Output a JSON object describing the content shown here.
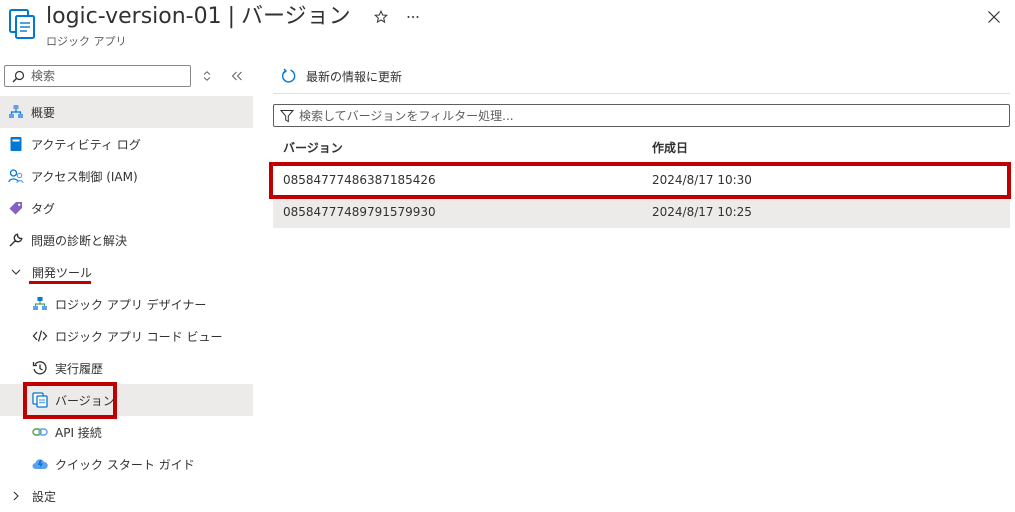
{
  "header": {
    "title": "logic-version-01",
    "separator": "|",
    "section": "バージョン",
    "subtitle": "ロジック アプリ",
    "favorite_icon": "star-icon",
    "more_icon": "ellipsis-icon",
    "close_icon": "close-icon"
  },
  "sidebar": {
    "search": {
      "placeholder": "検索",
      "value": ""
    },
    "items": [
      {
        "label": "概要",
        "icon": "overview-icon"
      },
      {
        "label": "アクティビティ ログ",
        "icon": "activity-log-icon"
      },
      {
        "label": "アクセス制御 (IAM)",
        "icon": "iam-icon"
      },
      {
        "label": "タグ",
        "icon": "tag-icon"
      },
      {
        "label": "問題の診断と解決",
        "icon": "wrench-icon"
      },
      {
        "label": "開発ツール",
        "icon": "chevron-down-icon"
      },
      {
        "label": "ロジック アプリ デザイナー",
        "icon": "designer-icon"
      },
      {
        "label": "ロジック アプリ コード ビュー",
        "icon": "code-icon"
      },
      {
        "label": "実行履歴",
        "icon": "history-icon"
      },
      {
        "label": "バージョン",
        "icon": "versions-icon"
      },
      {
        "label": "API 接続",
        "icon": "api-connection-icon"
      },
      {
        "label": "クイック スタート ガイド",
        "icon": "quickstart-icon"
      },
      {
        "label": "設定",
        "icon": "chevron-right-icon"
      }
    ]
  },
  "main": {
    "refresh_label": "最新の情報に更新",
    "filter": {
      "placeholder": "検索してバージョンをフィルター処理...",
      "value": ""
    },
    "columns": [
      "バージョン",
      "作成日"
    ],
    "rows": [
      {
        "version": "08584777486387185426",
        "created": "2024/8/17 10:30"
      },
      {
        "version": "08584777489791579930",
        "created": "2024/8/17 10:25"
      }
    ]
  },
  "colors": {
    "accent": "#0078d4",
    "highlight": "#c00000",
    "selected_bg": "#edebe9"
  }
}
